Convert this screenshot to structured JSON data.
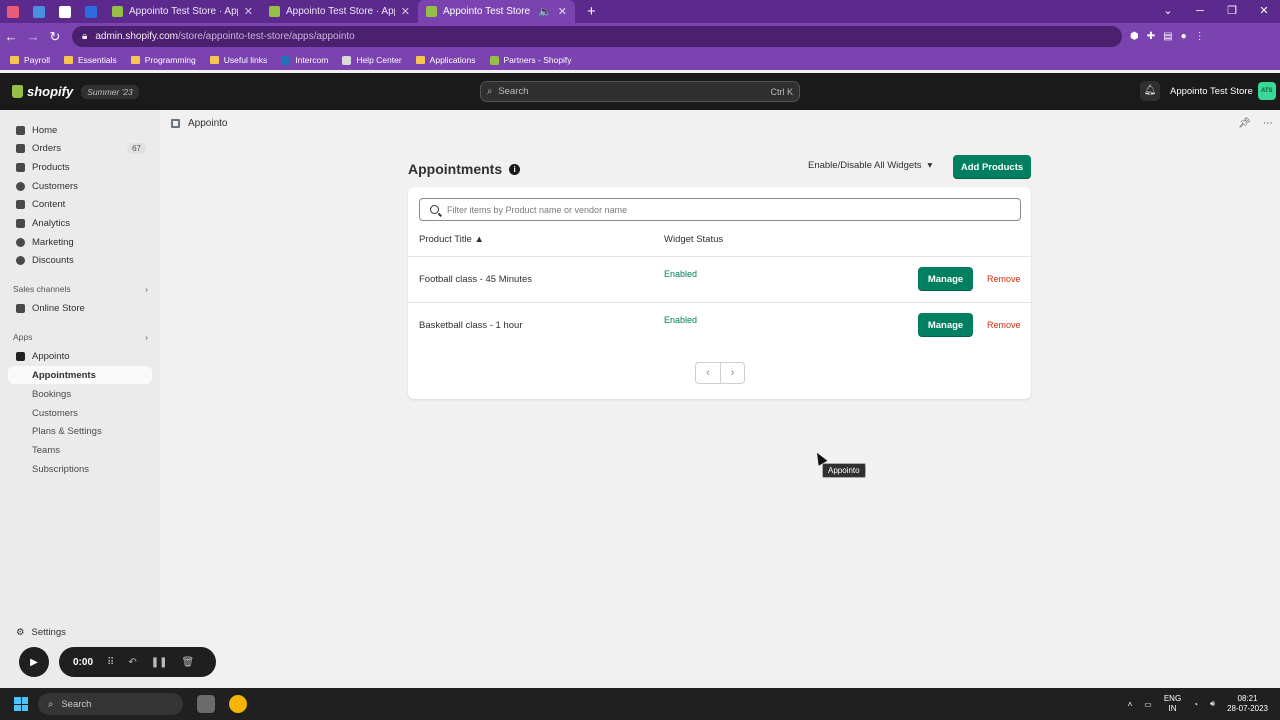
{
  "browser": {
    "tabs": [
      {
        "title": "Appointo Test Store · Appointo"
      },
      {
        "title": "Appointo Test Store · Appointo"
      },
      {
        "title": "Appointo Test Store · Appoin"
      }
    ],
    "url_host": "admin.shopify.com",
    "url_path": "/store/appointo-test-store/apps/appointo",
    "bookmarks": [
      "Payroll",
      "Essentials",
      "Programming",
      "Useful links",
      "Intercom",
      "Help Center",
      "Applications",
      "Partners - Shopify"
    ]
  },
  "topbar": {
    "brand": "shopify",
    "badge": "Summer '23",
    "search_placeholder": "Search",
    "search_shortcut": "Ctrl K",
    "store_name": "Appointo Test Store",
    "store_initials": "ATS"
  },
  "sidebar": {
    "items": [
      {
        "label": "Home"
      },
      {
        "label": "Orders",
        "count": "67"
      },
      {
        "label": "Products"
      },
      {
        "label": "Customers"
      },
      {
        "label": "Content"
      },
      {
        "label": "Analytics"
      },
      {
        "label": "Marketing"
      },
      {
        "label": "Discounts"
      }
    ],
    "sales_channels_label": "Sales channels",
    "online_store": "Online Store",
    "apps_label": "Apps",
    "app_name": "Appointo",
    "app_subitems": [
      "Appointments",
      "Bookings",
      "Customers",
      "Plans & Settings",
      "Teams",
      "Subscriptions"
    ],
    "settings": "Settings"
  },
  "main": {
    "breadcrumb": "Appointo",
    "title": "Appointments",
    "enable_all": "Enable/Disable All Widgets",
    "add_products": "Add Products",
    "filter_placeholder": "Filter items by Product name or vendor name",
    "col_product": "Product Title",
    "col_status": "Widget Status",
    "rows": [
      {
        "title": "Football class - 45 Minutes",
        "status": "Enabled",
        "manage": "Manage",
        "remove": "Remove"
      },
      {
        "title": "Basketball class - 1 hour",
        "status": "Enabled",
        "manage": "Manage",
        "remove": "Remove"
      }
    ],
    "tooltip": "Appointo"
  },
  "recorder": {
    "time": "0:00"
  },
  "taskbar": {
    "search": "Search",
    "lang": "ENG",
    "region": "IN",
    "time": "08:21",
    "date": "28-07-2023"
  }
}
